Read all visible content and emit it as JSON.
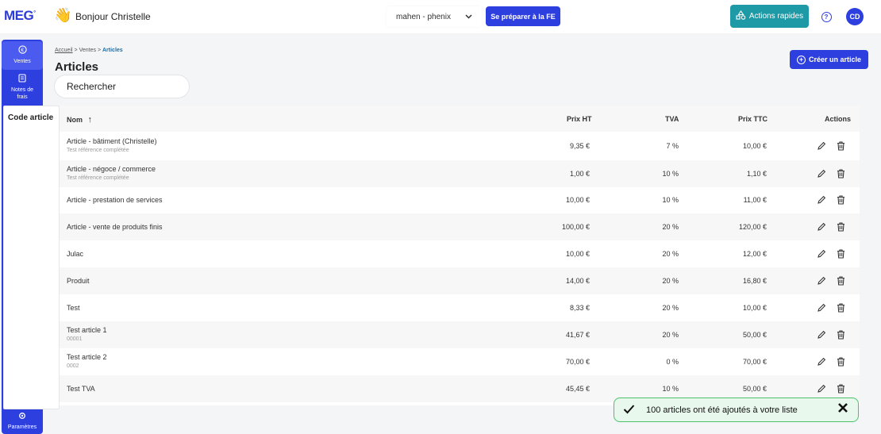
{
  "header": {
    "logo": "MEG",
    "logo_mark": "°",
    "greeting": "Bonjour Christelle",
    "company": "mahen - phenix",
    "fe_button": "Se préparer à la FE",
    "quick_actions": "Actions rapides",
    "avatar": "CD"
  },
  "sidebar": {
    "items": [
      {
        "label": "Ventes",
        "icon": "euro-icon"
      },
      {
        "label": "Notes de frais",
        "icon": "receipt-icon"
      },
      {
        "label": "Paramètres",
        "icon": "gear-icon"
      }
    ]
  },
  "breadcrumb": {
    "home": "Accueil",
    "sep": ">",
    "section": "Ventes",
    "current": "Articles"
  },
  "page": {
    "title": "Articles",
    "search_placeholder": "Rechercher",
    "create_button": "Créer un article",
    "code_panel_label": "Code article"
  },
  "table": {
    "columns": {
      "name": "Nom",
      "sort": "↑",
      "prix_ht": "Prix HT",
      "tva": "TVA",
      "prix_ttc": "Prix TTC",
      "actions": "Actions"
    },
    "rows": [
      {
        "name": "Article - bâtiment (Christelle)",
        "sub": "Test référence complétée",
        "ht": "9,35 €",
        "tva": "7 %",
        "ttc": "10,00 €"
      },
      {
        "name": "Article - négoce / commerce",
        "sub": "Test référence complétée",
        "ht": "1,00 €",
        "tva": "10 %",
        "ttc": "1,10 €"
      },
      {
        "name": "Article - prestation de services",
        "sub": "",
        "ht": "10,00 €",
        "tva": "10 %",
        "ttc": "11,00 €"
      },
      {
        "name": "Article - vente de produits finis",
        "sub": "",
        "ht": "100,00 €",
        "tva": "20 %",
        "ttc": "120,00 €"
      },
      {
        "name": "Julac",
        "sub": "",
        "ht": "10,00 €",
        "tva": "20 %",
        "ttc": "12,00 €"
      },
      {
        "name": "Produit",
        "sub": "",
        "ht": "14,00 €",
        "tva": "20 %",
        "ttc": "16,80 €"
      },
      {
        "name": "Test",
        "sub": "",
        "ht": "8,33 €",
        "tva": "20 %",
        "ttc": "10,00 €"
      },
      {
        "name": "Test article 1",
        "sub": "00001",
        "ht": "41,67 €",
        "tva": "20 %",
        "ttc": "50,00 €"
      },
      {
        "name": "Test article 2",
        "sub": "0002",
        "ht": "70,00 €",
        "tva": "0 %",
        "ttc": "70,00 €"
      },
      {
        "name": "Test TVA",
        "sub": "",
        "ht": "45,45 €",
        "tva": "10 %",
        "ttc": "50,00 €"
      }
    ]
  },
  "toast": {
    "message": "100 articles ont été ajoutés à votre liste"
  },
  "colors": {
    "primary": "#2e3fe0",
    "teal": "#1e9aa7",
    "toast_bg": "#e9f8ec",
    "toast_border": "#4ec06a"
  }
}
